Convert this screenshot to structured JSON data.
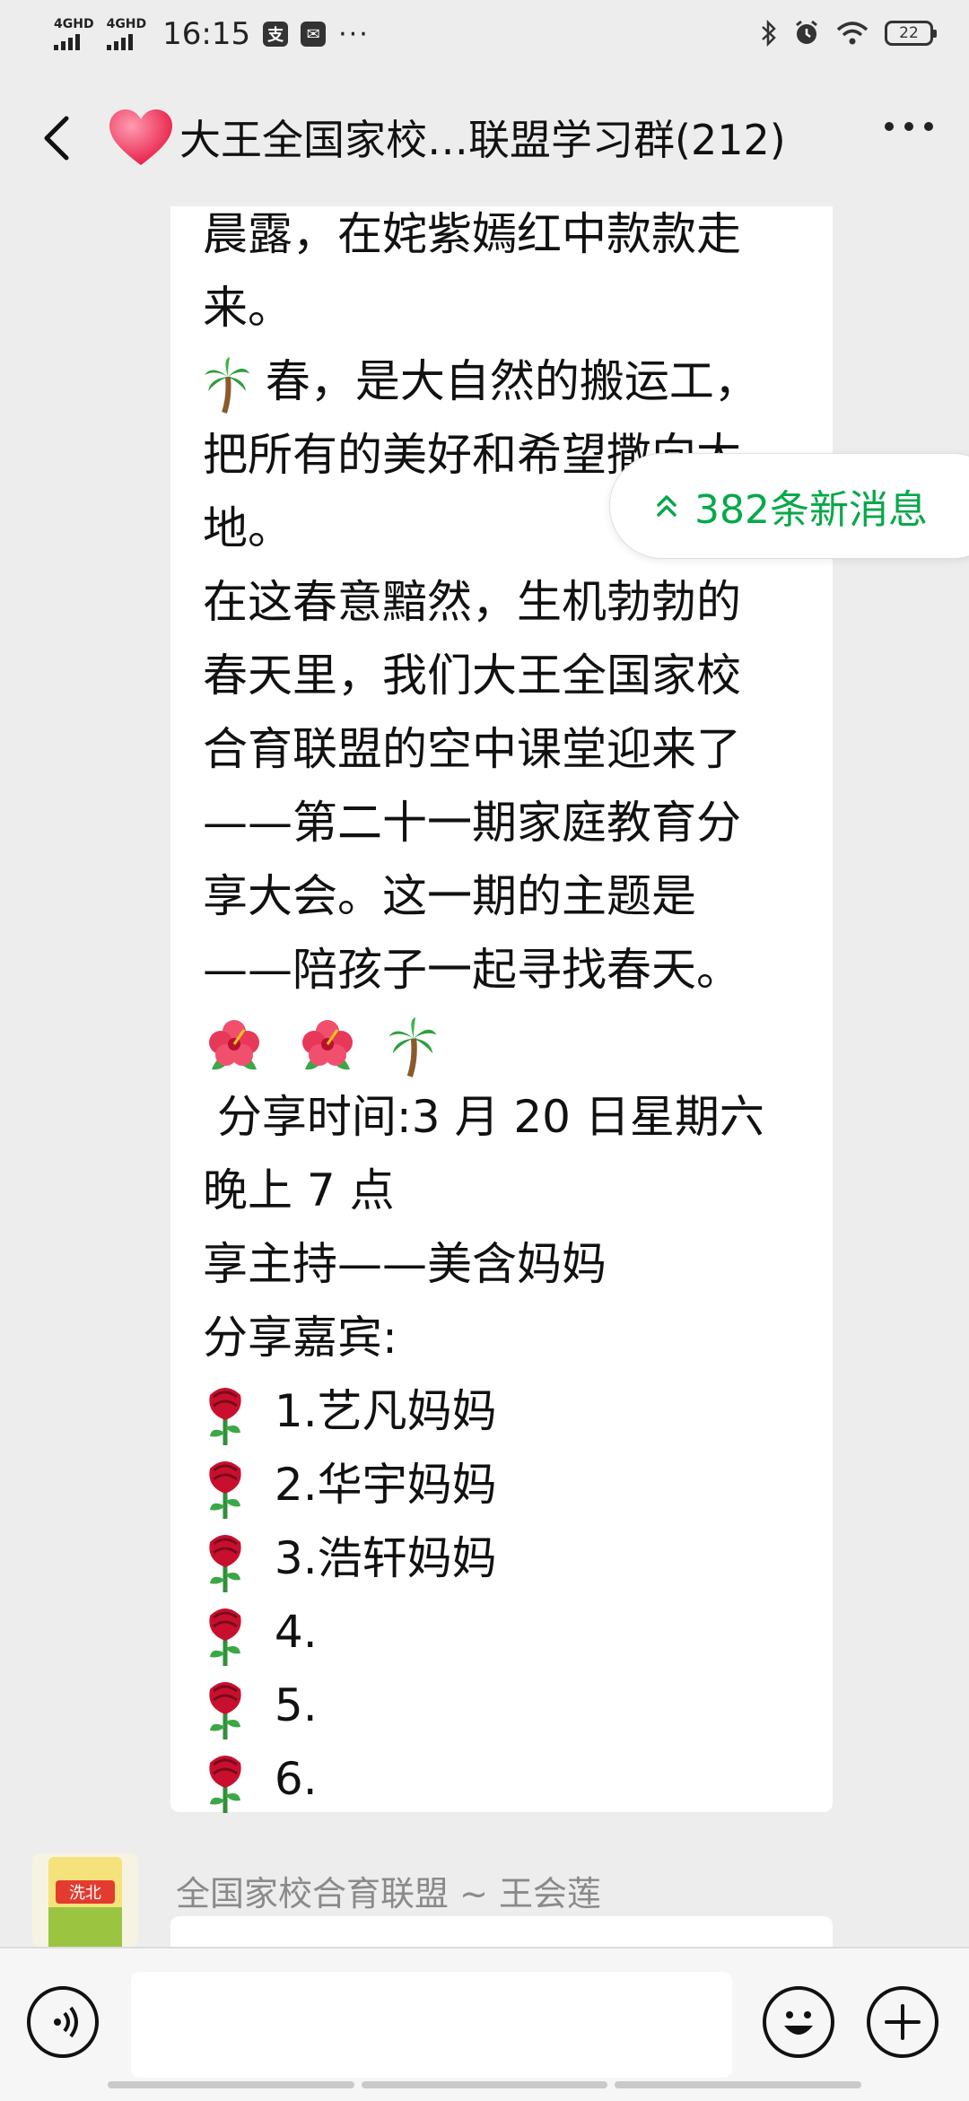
{
  "status_bar": {
    "network1": "4GHD",
    "network2": "4GHD",
    "time": "16:15",
    "battery": "22"
  },
  "header": {
    "title": "大王全国家校…联盟学习群(212)"
  },
  "new_messages": {
    "label": "382条新消息"
  },
  "message": {
    "lines": [
      "晨露，在姹紫嫣红中款款走",
      "来。",
      "春，是大自然的搬运工，",
      "把所有的美好和希望撒向大",
      "地。",
      "在这春意黯然，生机勃勃的",
      "春天里，我们大王全国家校",
      "合育联盟的空中课堂迎来了",
      "——第二十一期家庭教育分",
      "享大会。这一期的主题是",
      "——陪孩子一起寻找春天。",
      " 分享时间:3 月 20 日星期六",
      "晚上 7 点",
      "享主持——美含妈妈",
      "分享嘉宾:"
    ],
    "guests": [
      "1.艺凡妈妈",
      "2.华宇妈妈",
      "3.浩轩妈妈",
      "4.",
      "5.",
      "6."
    ]
  },
  "next_message": {
    "sender": "全国家校合育联盟 ~ 王会莲",
    "avatar_text": "洗北"
  },
  "icons": {
    "palm": "palm-tree-icon",
    "hibiscus": "hibiscus-icon",
    "rose": "rose-icon"
  },
  "colors": {
    "accent_green": "#07a84a",
    "background": "#ededed",
    "bubble": "#ffffff"
  }
}
